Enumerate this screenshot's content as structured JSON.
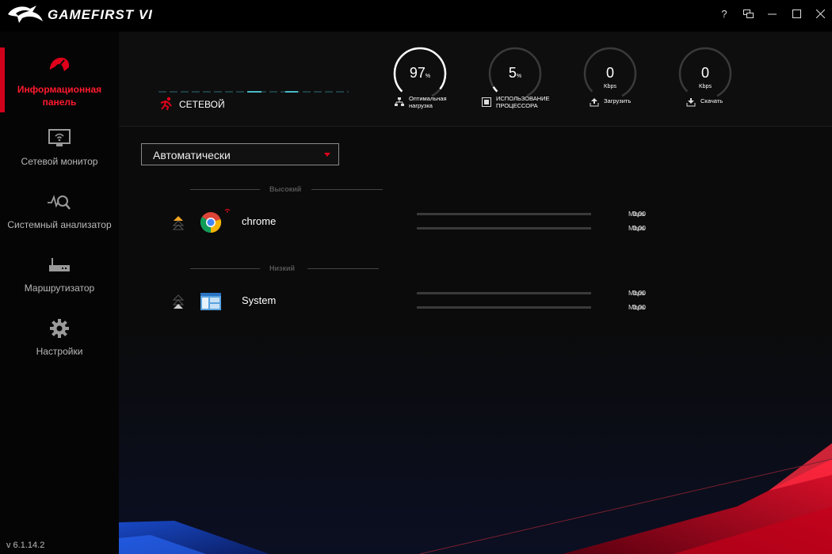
{
  "app": {
    "title": "GAMEFIRST VI",
    "version": "v 6.1.14.2"
  },
  "window_controls": {
    "help": "?",
    "restore_icon": "restore-icon",
    "minimize_icon": "minimize-icon",
    "maximize_icon": "maximize-icon",
    "close_icon": "close-icon"
  },
  "sidebar": {
    "items": [
      {
        "label": "Информационная панель",
        "icon": "dashboard-speedometer-icon",
        "active": true
      },
      {
        "label": "Сетевой монитор",
        "icon": "network-monitor-icon",
        "active": false
      },
      {
        "label": "Системный анализатор",
        "icon": "system-analyzer-icon",
        "active": false
      },
      {
        "label": "Маршрутизатор",
        "icon": "router-icon",
        "active": false
      },
      {
        "label": "Настройки",
        "icon": "gear-icon",
        "active": false
      }
    ]
  },
  "header": {
    "network_label": "СЕТЕВОЙ",
    "gauges": [
      {
        "value": "97",
        "unit": "%",
        "label": "Оптимальная нагрузка",
        "label_lines": [
          "Оптимальная",
          "нагрузка"
        ],
        "icon": "network-load-icon",
        "fill": 0.97
      },
      {
        "value": "5",
        "unit": "%",
        "label": "ИСПОЛЬЗОВАНИЕ ПРОЦЕССОРА",
        "label_lines": [
          "ИСПОЛЬЗОВАНИЕ",
          "ПРОЦЕССОРА"
        ],
        "icon": "cpu-icon",
        "fill": 0.05
      },
      {
        "value": "0",
        "sub": "Kbps",
        "label": "Загрузить",
        "icon": "upload-icon",
        "fill": 0
      },
      {
        "value": "0",
        "sub": "Kbps",
        "label": "Скачать",
        "icon": "download-icon",
        "fill": 0
      }
    ]
  },
  "mode_select": {
    "value": "Автоматически"
  },
  "groups": [
    {
      "label": "Высокий",
      "apps": [
        {
          "name": "chrome",
          "icon": "chrome-icon",
          "priority": "high",
          "rates": [
            {
              "value": "0,00",
              "unit": "Mbps"
            },
            {
              "value": "0,00",
              "unit": "Mbps"
            }
          ]
        }
      ]
    },
    {
      "label": "Низкий",
      "apps": [
        {
          "name": "System",
          "icon": "system-window-icon",
          "priority": "low",
          "rates": [
            {
              "value": "0,00",
              "unit": "Mbps"
            },
            {
              "value": "0,00",
              "unit": "Mbps"
            }
          ]
        }
      ]
    }
  ],
  "colors": {
    "accent": "#d0021b",
    "ring": "#ffffff",
    "ring_track": "#3a3a3a",
    "priority_high": "#f5a623",
    "blue_art": "#1a4fd8"
  }
}
